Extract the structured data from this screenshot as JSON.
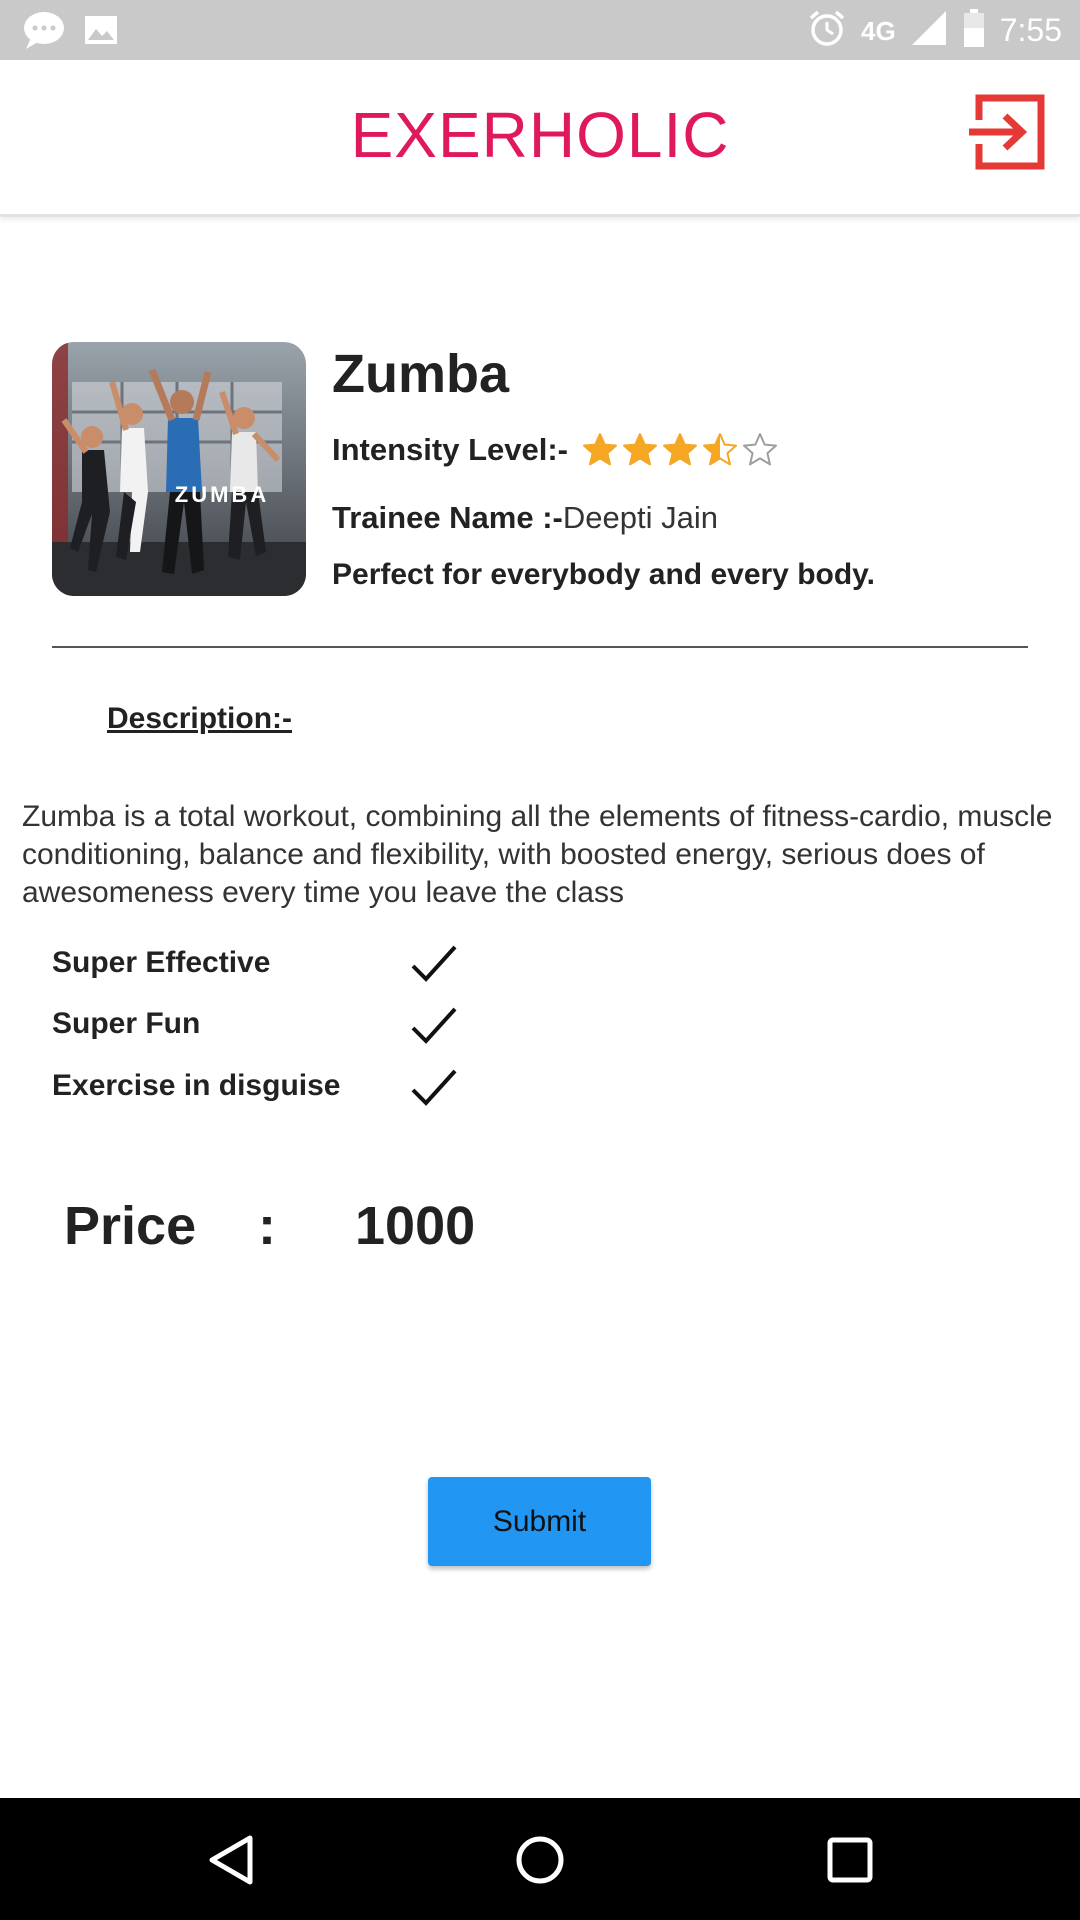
{
  "status_bar": {
    "time": "7:55",
    "network": "4G",
    "icons": [
      "message-bubble-icon",
      "image-icon",
      "alarm-icon",
      "signal-icon",
      "battery-icon"
    ]
  },
  "app_bar": {
    "title": "EXERHOLIC",
    "title_color": "#e0195f",
    "action_icon": "logout-icon",
    "action_color": "#e53935"
  },
  "class": {
    "thumbnail_text": "ZUMBA",
    "title": "Zumba",
    "intensity_label": "Intensity Level:-",
    "intensity_rating": 3.5,
    "intensity_max": 5,
    "star_color": "#f5a623",
    "trainee_label": "Trainee Name :-",
    "trainee_name": "Deepti Jain",
    "tagline": "Perfect for everybody and every body."
  },
  "description": {
    "heading": "Description:-",
    "text": "Zumba is a total workout, combining all the elements of fitness-cardio, muscle conditioning, balance and flexibility, with boosted energy, serious does of awesomeness every time you leave the class"
  },
  "features": [
    {
      "label": "Super Effective",
      "checked": true
    },
    {
      "label": "Super Fun",
      "checked": true
    },
    {
      "label": "Exercise in disguise",
      "checked": true
    }
  ],
  "price": {
    "label": "Price",
    "separator": ":",
    "value": "1000"
  },
  "submit_button": {
    "label": "Submit",
    "color": "#2196f3"
  },
  "nav_bar": {
    "buttons": [
      "back-icon",
      "home-icon",
      "recents-icon"
    ]
  }
}
